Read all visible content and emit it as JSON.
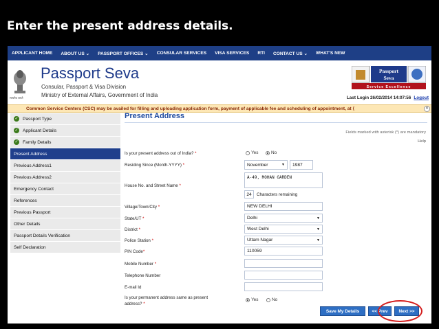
{
  "slide_title": "Enter the present address details.",
  "nav": [
    "APPLICANT HOME",
    "ABOUT US ⌄",
    "PASSPORT OFFICES ⌄",
    "CONSULAR SERVICES",
    "VISA SERVICES",
    "RTI",
    "CONTACT US ⌄",
    "WHAT'S NEW"
  ],
  "header": {
    "title": "Passport Seva",
    "sub1": "Consular, Passport & Visa Division",
    "sub2": "Ministry of External Affairs, Government of India",
    "emblem_caption": "सत्यमेव जयते",
    "logo_line1": "Passport",
    "logo_line2": "Seva",
    "logo_tagline": "Service Excellence",
    "last_login": "Last Login 26/02/2014 14:07:56",
    "logout": "Logout"
  },
  "ticker": "Common Service Centers (CSC) may be availed for filling and uploading application form, payment of applicable fee and scheduling of appointment, at ⟨",
  "sidebar": [
    {
      "label": "Passport Type",
      "done": true
    },
    {
      "label": "Applicant Details",
      "done": true
    },
    {
      "label": "Family Details",
      "done": true
    },
    {
      "label": "Present Address",
      "active": true
    },
    {
      "label": "Previous Address1"
    },
    {
      "label": "Previous Address2"
    },
    {
      "label": "Emergency Contact"
    },
    {
      "label": "References"
    },
    {
      "label": "Previous Passport"
    },
    {
      "label": "Other Details"
    },
    {
      "label": "Passport Details Verification"
    },
    {
      "label": "Self Declaration"
    }
  ],
  "form": {
    "title": "Present Address",
    "mandatory_note": "Fields marked with asterisk (*) are mandatory",
    "help": "Help",
    "out_of_india_label": "Is your present address out of India?",
    "yes": "Yes",
    "no": "No",
    "residing_since_label": "Residing Since (Month-YYYY)",
    "residing_month": "November",
    "residing_year": "1987",
    "house_label": "House No. and Street Name",
    "house_value": "A-49, MOHAN GARDEN",
    "chars_remaining_count": "24",
    "chars_remaining_label": "Characters remaining",
    "village_label": "Village/Town/City",
    "village_value": "NEW DELHI",
    "state_label": "State/UT",
    "state_value": "Delhi",
    "district_label": "District",
    "district_value": "West Delhi",
    "police_label": "Police Station",
    "police_value": "Uttam Nagar",
    "pin_label": "PIN Code",
    "pin_value": "110059",
    "mobile_label": "Mobile Number",
    "telephone_label": "Telephone Number",
    "email_label": "E-mail Id",
    "permanent_label_1": "Is your permanent address same as present",
    "permanent_label_2": "address?",
    "save_button": "Save My Details",
    "prev_button": "<< Prev",
    "next_button": "Next >>"
  }
}
